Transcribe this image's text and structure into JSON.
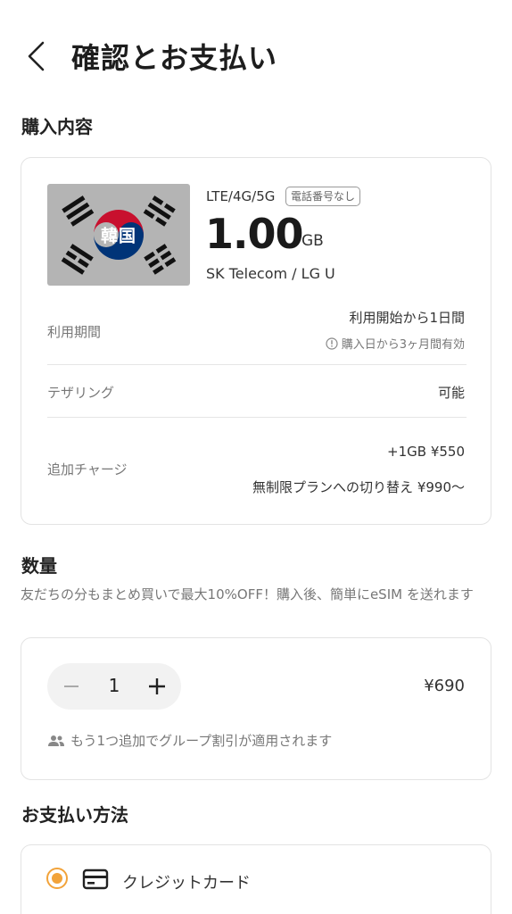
{
  "header": {
    "title": "確認とお支払い",
    "back_icon": "chevron-left-icon"
  },
  "purchase": {
    "section_title": "購入内容",
    "flag_label": "韓国",
    "network_types": "LTE/4G/5G",
    "badge": "電話番号なし",
    "data_amount": "1.00",
    "data_unit": "GB",
    "carrier": "SK Telecom / LG U",
    "rows": [
      {
        "label": "利用期間",
        "value": "利用開始から1日間",
        "note": "購入日から3ヶ月間有効"
      },
      {
        "label": "テザリング",
        "value": "可能"
      },
      {
        "label": "追加チャージ",
        "value": "+1GB ¥550",
        "value2": "無制限プランへの切り替え ¥990〜"
      }
    ]
  },
  "quantity": {
    "section_title": "数量",
    "description": "友だちの分もまとめ買いで最大10%OFF！購入後、簡単にeSIM を送れます",
    "value": "1",
    "price": "¥690",
    "group_note": "もう1つ追加でグループ割引が適用されます"
  },
  "payment": {
    "section_title": "お支払い方法",
    "method_label": "クレジットカード",
    "selected": true
  },
  "colors": {
    "accent": "#f2a33a",
    "flag_bg": "#b4b4b4",
    "taeguk_red": "#c8102e",
    "taeguk_blue": "#003478"
  }
}
